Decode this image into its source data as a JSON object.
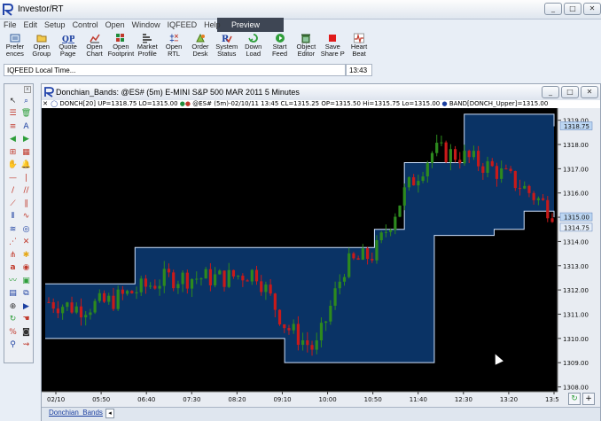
{
  "app": {
    "title": "Investor/RT",
    "menu": [
      "File",
      "Edit",
      "Setup",
      "Control",
      "Open",
      "Window",
      "IQFEED",
      "Help"
    ],
    "preview_label": "Preview",
    "window_buttons": [
      "_",
      "□",
      "✕"
    ]
  },
  "toolbar": {
    "buttons": [
      {
        "label": "Prefer\nences",
        "icon": "preferences-icon"
      },
      {
        "label": "Open\nGroup",
        "icon": "folder-icon"
      },
      {
        "label": "Quote\nPage",
        "icon": "quote-page-icon"
      },
      {
        "label": "Open\nChart",
        "icon": "chart-icon"
      },
      {
        "label": "Open\nFootprint",
        "icon": "footprint-icon"
      },
      {
        "label": "Market\nProfile",
        "icon": "market-profile-icon"
      },
      {
        "label": "Open\nRTL",
        "icon": "rtl-icon"
      },
      {
        "label": "Order\nDesk",
        "icon": "order-desk-icon"
      },
      {
        "label": "System\nStatus",
        "icon": "system-status-icon"
      },
      {
        "label": "Down\nLoad",
        "icon": "download-icon"
      },
      {
        "label": "Start\nFeed",
        "icon": "start-feed-icon"
      },
      {
        "label": "Object\nEditor",
        "icon": "object-editor-icon"
      },
      {
        "label": "Save\nShare P",
        "icon": "save-share-icon"
      },
      {
        "label": "Heart\nBeat",
        "icon": "heartbeat-icon"
      }
    ],
    "status_text": "IQFEED Local Time...",
    "time_text": "13:43"
  },
  "chart_window": {
    "title": "Donchian_Bands: @ES# (5m) E-MINI S&P 500 MAR 2011 5 Minutes",
    "legend": {
      "close": "✕",
      "donch": "DONCH[20] UP=1318.75 LO=1315.00",
      "price": "@ES# (5m)-02/10/11 13:45 CL=1315.25 OP=1315.50 Hi=1315.75 Lo=1315.00",
      "band": "BAND[DONCH_Upper]=1315.00"
    },
    "tab_label": "Donchian_Bands",
    "tab_arrow": "◂",
    "colors": {
      "background": "#000000",
      "band_fill": "#0a3365",
      "band_line": "#cfe3ff",
      "up_candle": "#2d8a1e",
      "down_candle": "#c81a1a"
    }
  },
  "chart_data": {
    "type": "candlestick",
    "ylim": [
      1307.8,
      1319.5
    ],
    "y_ticks": [
      "1319.00",
      "1318.00",
      "1317.00",
      "1316.00",
      "1315.00",
      "1314.00",
      "1313.00",
      "1312.00",
      "1311.00",
      "1310.00",
      "1309.00",
      "1308.00"
    ],
    "price_labels": [
      "1318.75",
      "1315.00",
      "1314.75"
    ],
    "x_ticks": [
      "02/10",
      "05:50",
      "06:40",
      "07:30",
      "08:20",
      "09:10",
      "10:00",
      "10:50",
      "11:40",
      "12:30",
      "13:20",
      "13:5"
    ],
    "donchian_upper": [
      1312.25,
      1312.25,
      1312.25,
      1313.75,
      1313.75,
      1313.75,
      1313.75,
      1313.75,
      1313.75,
      1313.75,
      1313.75,
      1314.5,
      1317.25,
      1317.25,
      1319.25,
      1319.25,
      1319.25,
      1318.75
    ],
    "donchian_lower": [
      1310.0,
      1310.0,
      1310.0,
      1310.0,
      1310.0,
      1310.0,
      1310.0,
      1310.0,
      1309.0,
      1309.0,
      1309.0,
      1309.0,
      1309.0,
      1314.25,
      1314.25,
      1314.5,
      1315.25,
      1315.0
    ],
    "close": [
      1311.5,
      1311.25,
      1311.5,
      1312.0,
      1312.5,
      1312.5,
      1312.5,
      1312.75,
      1310.5,
      1309.5,
      1313.0,
      1313.5,
      1316.0,
      1317.75,
      1317.5,
      1317.0,
      1316.25,
      1315.25
    ]
  }
}
